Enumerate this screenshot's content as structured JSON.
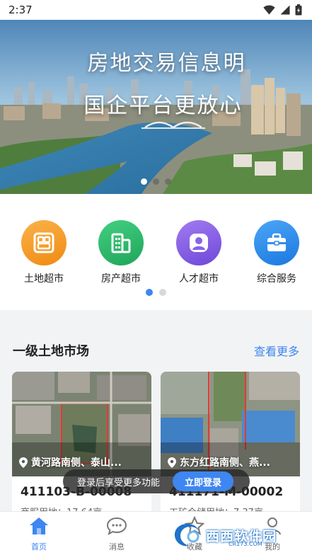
{
  "status_bar": {
    "time": "2:37",
    "icons": [
      "wifi-icon",
      "signal-icon",
      "battery-icon"
    ]
  },
  "banner": {
    "title_line1": "房地交易信息明",
    "title_line2": "国企平台更放心",
    "slide_count": 3,
    "active_slide": 1
  },
  "quick_menu": {
    "items": [
      {
        "label": "土地超市",
        "icon": "land-market-icon",
        "color": "#f59a23"
      },
      {
        "label": "房产超市",
        "icon": "building-icon",
        "color": "#2bb56b"
      },
      {
        "label": "人才超市",
        "icon": "person-icon",
        "color": "#8a62e8"
      },
      {
        "label": "综合服务",
        "icon": "briefcase-icon",
        "color": "#2f8ff0"
      }
    ],
    "page_count": 2,
    "active_page": 1
  },
  "section": {
    "title": "一级土地市场",
    "more_label": "查看更多",
    "cards": [
      {
        "location": "黄河路南侧、泰山...",
        "code": "411103-B-00008",
        "use": "商服用地：17.64亩"
      },
      {
        "location": "东方红路南侧、燕...",
        "code": "411171-M-00002",
        "use": "工矿仓储用地：7.37亩"
      }
    ]
  },
  "login_toast": {
    "message": "登录后享受更多功能",
    "button_label": "立即登录"
  },
  "bottom_nav": {
    "items": [
      {
        "label": "首页",
        "icon": "home-icon",
        "active": true
      },
      {
        "label": "消息",
        "icon": "chat-icon",
        "active": false
      },
      {
        "label": "收藏",
        "icon": "star-icon",
        "active": false
      },
      {
        "label": "我的",
        "icon": "profile-icon",
        "active": false
      }
    ]
  },
  "watermark": {
    "text": "西西软件园",
    "sub": "CR173.COM"
  },
  "colors": {
    "accent": "#3e86f0",
    "background": "#f2f3f5"
  }
}
